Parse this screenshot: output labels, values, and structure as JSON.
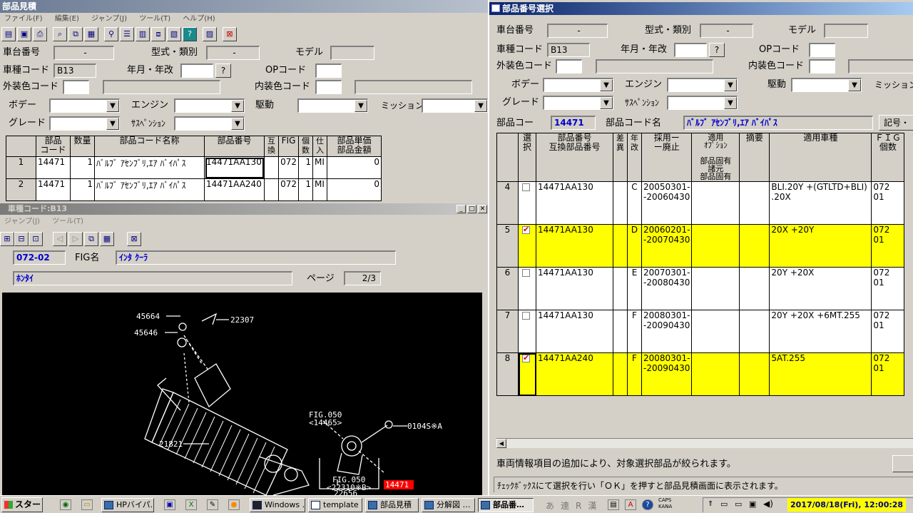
{
  "left_window": {
    "title": "部品見積",
    "menu": [
      "ファイル(F)",
      "編集(E)",
      "ジャンプ(J)",
      "ツール(T)",
      "ヘルプ(H)"
    ],
    "toolbar_icons": [
      "open-icon",
      "save-icon",
      "print-icon",
      "search-icon",
      "copy-icon",
      "clipboard-icon",
      "tree-icon",
      "list-icon",
      "chart-icon",
      "flow-icon",
      "image-icon",
      "help-icon",
      "doc-icon",
      "export-icon"
    ],
    "labels": {
      "chassis": "車台番号",
      "model_type": "型式・類別",
      "model": "モデル",
      "car_code": "車種コード",
      "date": "年月・年改",
      "op_code": "OPコード",
      "ext_color": "外装色コード",
      "int_color": "内装色コード",
      "body": "ボデー",
      "engine": "エンジン",
      "drive": "駆動",
      "mission": "ミッション",
      "grade": "グレード",
      "suspension": "ｻｽﾍﾟﾝｼｮﾝ"
    },
    "values": {
      "chassis": "-",
      "model_type": "-",
      "car_code": "B13",
      "date_button": "?"
    },
    "table": {
      "headers": [
        "部品\nコード",
        "数量",
        "部品コード名称",
        "部品番号",
        "互換",
        "FIG",
        "個数",
        "仕入",
        "部品単価\n部品金額"
      ],
      "rows": [
        {
          "no": "1",
          "code": "14471",
          "qty": "1",
          "name": "ﾊﾞﾙﾌﾞ ｱｾﾝﾌﾞﾘ,ｴｱ ﾊﾞｲﾊﾟｽ",
          "part": "14471AA130",
          "compat": "",
          "fig": "072",
          "count": "1",
          "buy": "MI",
          "price": "0"
        },
        {
          "no": "2",
          "code": "14471",
          "qty": "1",
          "name": "ﾊﾞﾙﾌﾞ ｱｾﾝﾌﾞﾘ,ｴｱ ﾊﾞｲﾊﾟｽ",
          "part": "14471AA240",
          "compat": "",
          "fig": "072",
          "count": "1",
          "buy": "MI",
          "price": "0"
        }
      ]
    }
  },
  "diagram_window": {
    "title": "車種コード:B13",
    "menu": [
      "ジャンプ(J)",
      "ツール(T)"
    ],
    "fig_no": "072-02",
    "fig_name_label": "FIG名",
    "fig_name": "ｲﾝﾀ ｸｰﾗ",
    "section": "ﾎﾝﾀｲ",
    "page_label": "ページ",
    "page": "2/3",
    "callouts": [
      "45664",
      "22307",
      "45646",
      "FIG.050",
      "<14465>",
      "0104S※A",
      "21821",
      "FIG.050",
      "<22310※B>",
      "14471",
      "22656"
    ]
  },
  "right_window": {
    "title": "部品番号選択",
    "labels": {
      "chassis": "車台番号",
      "model_type": "型式・類別",
      "model": "モデル",
      "car_code": "車種コード",
      "date": "年月・年改",
      "op_code": "OPコード",
      "ext_color": "外装色コード",
      "int_color": "内装色コード",
      "body": "ボデー",
      "engine": "エンジン",
      "drive": "駆動",
      "mission": "ミッション",
      "grade": "グレード",
      "suspension": "ｻｽﾍﾟﾝｼｮﾝ",
      "part_code": "部品コー",
      "part_code_name": "部品コード名",
      "symbol": "記号・"
    },
    "values": {
      "chassis": "-",
      "model_type": "-",
      "car_code": "B13",
      "date_button": "?",
      "part_code": "14471",
      "part_code_name": "ﾊﾞﾙﾌﾞ ｱｾﾝﾌﾞﾘ,ｴｱ ﾊﾞｲﾊﾟｽ"
    },
    "table": {
      "headers": {
        "select": "選\n択",
        "part": "部品番号\n互換部品番号",
        "diff": "差\n異",
        "year": "年\n改",
        "adopt": "採用ー\nー廃止",
        "option": "適用\nｵﾌﾟｼｮﾝ\n\n部品固有\n諸元\n部品固有",
        "summary": "摘要",
        "apply": "適用車種",
        "fig": "ＦＩＧ\n個数"
      },
      "rows": [
        {
          "no": "4",
          "checked": false,
          "part": "14471AA130",
          "year": "C",
          "adopt": "20050301-\n-20060430",
          "apply": "BLI.20Y +(GTLTD+BLI)\n.20X",
          "fig": "072\n01",
          "hl": false
        },
        {
          "no": "5",
          "checked": true,
          "part": "14471AA130",
          "year": "D",
          "adopt": "20060201-\n-20070430",
          "apply": "20X +20Y",
          "fig": "072\n01",
          "hl": true
        },
        {
          "no": "6",
          "checked": false,
          "part": "14471AA130",
          "year": "E",
          "adopt": "20070301-\n-20080430",
          "apply": "20Y +20X",
          "fig": "072\n01",
          "hl": false
        },
        {
          "no": "7",
          "checked": false,
          "part": "14471AA130",
          "year": "F",
          "adopt": "20080301-\n-20090430",
          "apply": "20Y +20X +6MT.255",
          "fig": "072\n01",
          "hl": false
        },
        {
          "no": "8",
          "checked": true,
          "part": "14471AA240",
          "year": "F",
          "adopt": "20080301-\n-20090430",
          "apply": "5AT.255",
          "fig": "072\n01",
          "hl": true
        }
      ]
    },
    "status1": "車両情報項目の追加により、対象選択部品が絞られます。",
    "status2": "ﾁｪｯｸﾎﾞｯｸｽにて選択を行い「ＯＫ」を押すと部品見積画面に表示されます。"
  },
  "taskbar": {
    "start": "スタート",
    "tasks": [
      "HPバイパ…",
      "Windows …",
      "template …",
      "部品見積",
      "分解図 …",
      "部品番…"
    ],
    "ime": [
      "あ",
      "連",
      "R",
      "漢"
    ],
    "caps": "CAPS\nKANA",
    "clock": "2017/08/18(Fri), 12:00:28"
  }
}
